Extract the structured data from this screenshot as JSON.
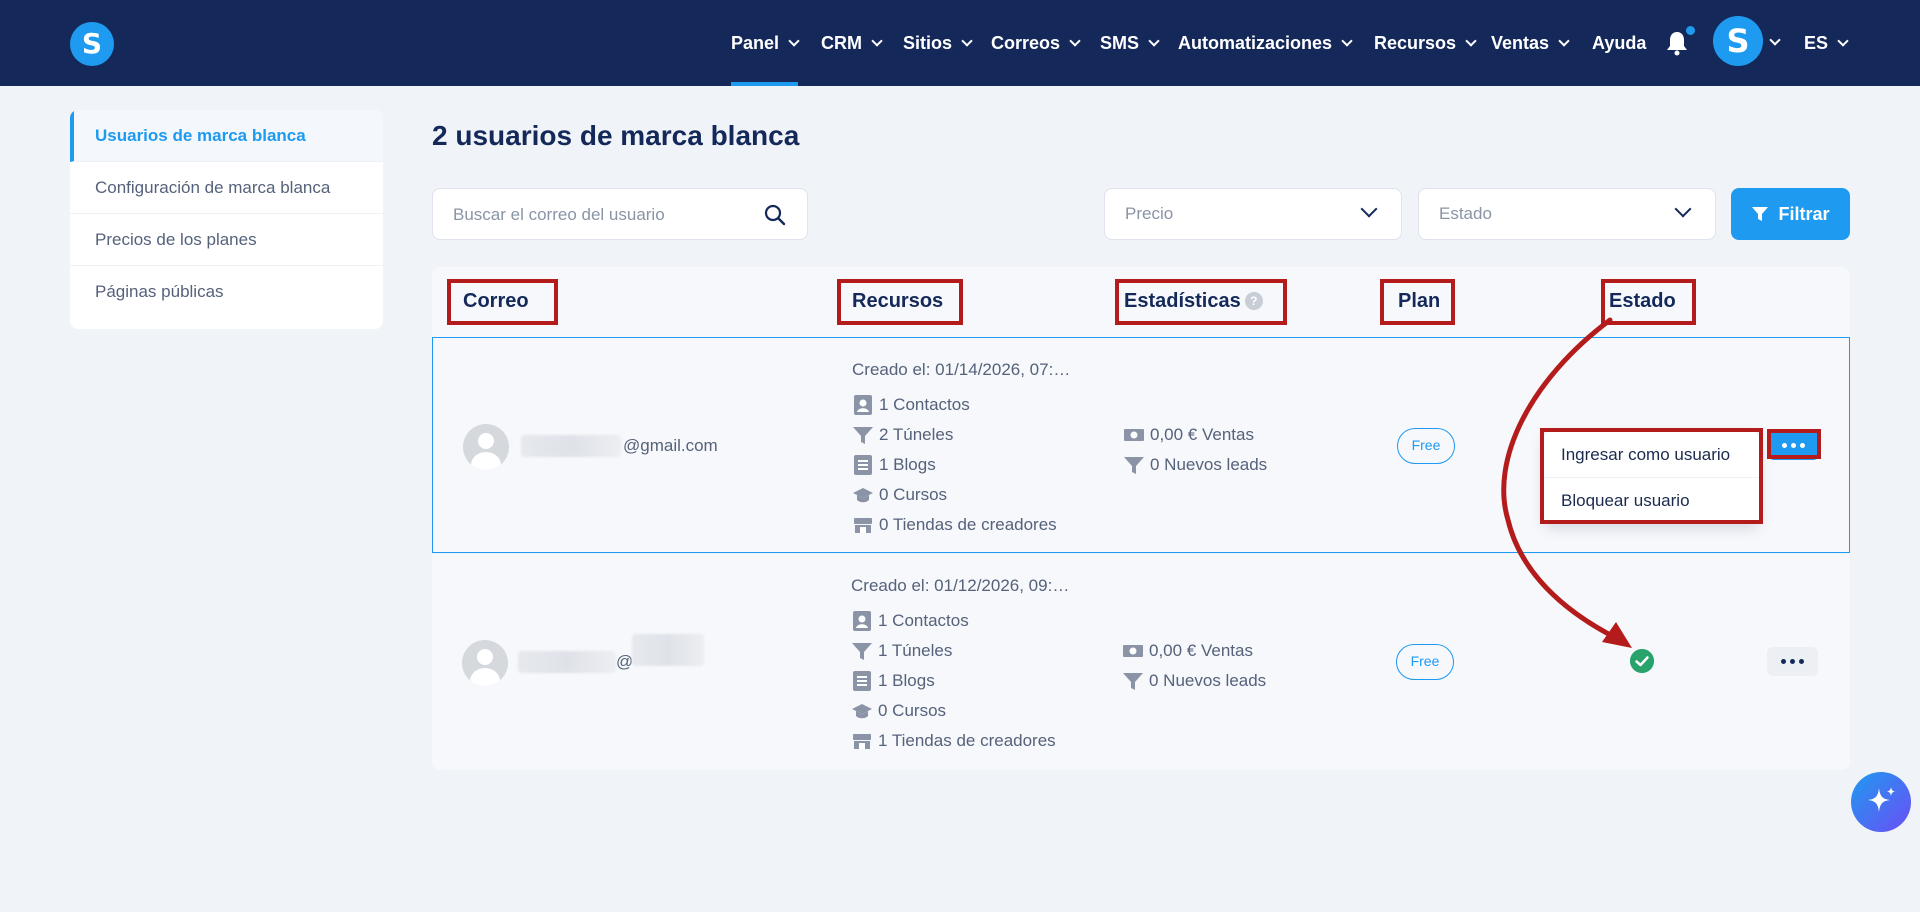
{
  "app": {
    "logo_letter": "S",
    "language": "ES",
    "avatar_letter": "S"
  },
  "nav": [
    {
      "label": "Panel",
      "active": true
    },
    {
      "label": "CRM"
    },
    {
      "label": "Sitios"
    },
    {
      "label": "Correos"
    },
    {
      "label": "SMS"
    },
    {
      "label": "Automatizaciones"
    },
    {
      "label": "Recursos"
    },
    {
      "label": "Ventas"
    },
    {
      "label": "Ayuda"
    }
  ],
  "sidebar": {
    "items": [
      {
        "label": "Usuarios de marca blanca",
        "active": true
      },
      {
        "label": "Configuración de marca blanca"
      },
      {
        "label": "Precios de los planes"
      },
      {
        "label": "Páginas públicas"
      }
    ]
  },
  "main": {
    "title": "2 usuarios de marca blanca",
    "search_placeholder": "Buscar el correo del usuario",
    "price_select": "Precio",
    "status_select": "Estado",
    "filter_label": "Filtrar"
  },
  "table": {
    "headers": {
      "email": "Correo",
      "resources": "Recursos",
      "stats": "Estadísticas",
      "plan": "Plan",
      "status": "Estado"
    },
    "rows": [
      {
        "email_suffix": "@gmail.com",
        "created": "Creado el: 01/14/2026, 07:…",
        "contacts": "1 Contactos",
        "funnels": "2 Túneles",
        "blogs": "1 Blogs",
        "courses": "0 Cursos",
        "stores": "0 Tiendas de creadores",
        "sales": "0,00 € Ventas",
        "leads": "0 Nuevos leads",
        "plan": "Free"
      },
      {
        "email_suffix": "@",
        "created": "Creado el: 01/12/2026, 09:…",
        "contacts": "1 Contactos",
        "funnels": "1 Túneles",
        "blogs": "1 Blogs",
        "courses": "0 Cursos",
        "stores": "1 Tiendas de creadores",
        "sales": "0,00 € Ventas",
        "leads": "0 Nuevos leads",
        "plan": "Free"
      }
    ]
  },
  "row_menu": {
    "login_as": "Ingresar como usuario",
    "block": "Bloquear usuario"
  },
  "colors": {
    "navbar": "#14295a",
    "accent": "#1e9af0",
    "highlight": "#b41c1c",
    "success": "#27a36b"
  }
}
